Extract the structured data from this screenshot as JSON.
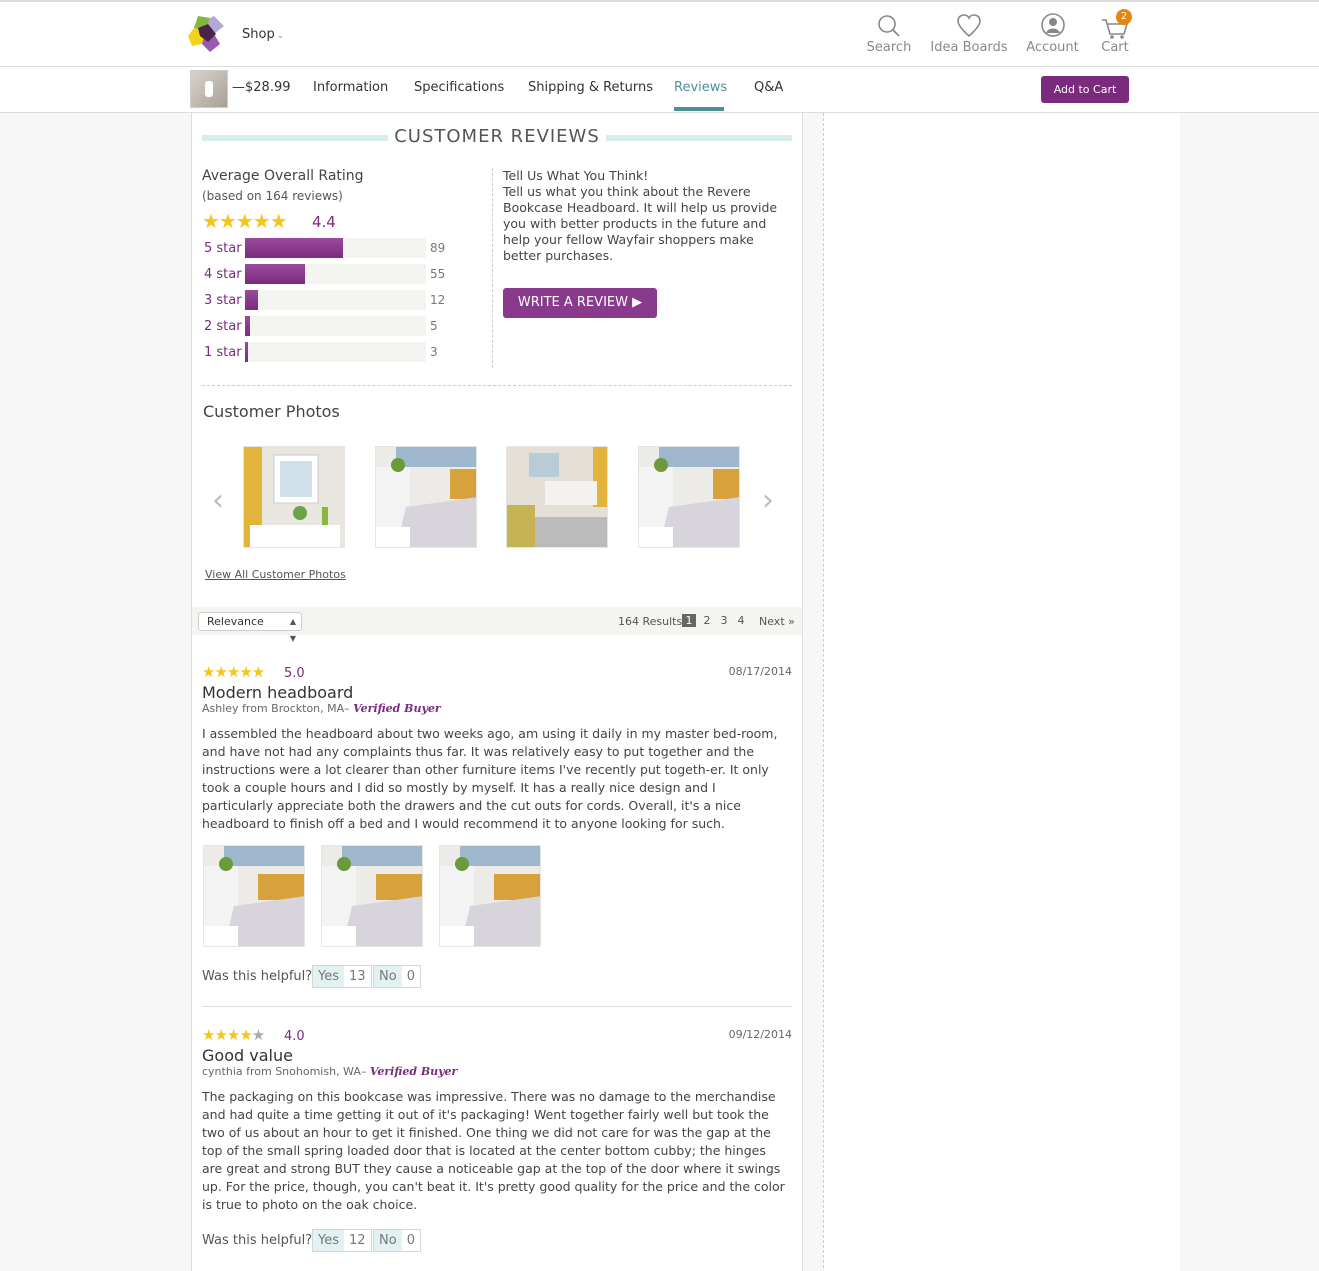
{
  "header": {
    "shop_label": "Shop",
    "nav": [
      {
        "label": "Search",
        "icon": "search-icon"
      },
      {
        "label": "Idea Boards",
        "icon": "heart-icon"
      },
      {
        "label": "Account",
        "icon": "account-icon"
      },
      {
        "label": "Cart",
        "icon": "cart-icon",
        "badge": "2"
      }
    ],
    "colors": {
      "accent": "#7b2b7e",
      "teal": "#4e8f9a",
      "badge": "#e8850f"
    }
  },
  "subnav": {
    "price": "—$28.99",
    "tabs": [
      "Information",
      "Specifications",
      "Shipping & Returns",
      "Reviews",
      "Q&A"
    ],
    "active_tab": "Reviews",
    "add_to_cart": "Add to Cart"
  },
  "reviews_summary": {
    "title": "CUSTOMER REVIEWS",
    "avg_label": "Average Overall Rating",
    "based_on": "(based on 164 reviews)",
    "avg_value": "4.4",
    "avg_stars": "★★★★★",
    "breakdown": [
      {
        "label": "5 star",
        "count": "89",
        "fraction": 0.54
      },
      {
        "label": "4 star",
        "count": "55",
        "fraction": 0.33
      },
      {
        "label": "3 star",
        "count": "12",
        "fraction": 0.07
      },
      {
        "label": "2 star",
        "count": "5",
        "fraction": 0.025
      },
      {
        "label": "1 star",
        "count": "3",
        "fraction": 0.018
      }
    ],
    "tell_title": "Tell Us What You Think!",
    "tell_body": "Tell us what you think about the Revere Bookcase Headboard. It will help us provide you with better products in the future and help your fellow Wayfair shoppers make better purchases.",
    "write_button": "WRITE A REVIEW ▶"
  },
  "customer_photos": {
    "title": "Customer Photos",
    "view_all": "View All Customer Photos"
  },
  "toolbar": {
    "sort_value": "Relevance",
    "results": "164 Results",
    "pages": [
      "1",
      "2",
      "3",
      "4"
    ],
    "current_page": "1",
    "next": "Next »"
  },
  "reviews": [
    {
      "stars": "★★★★★",
      "score": "5.0",
      "date": "08/17/2014",
      "title": "Modern headboard",
      "author": "Ashley from Brockton, MA–",
      "verified": "Verified Buyer",
      "body": "I assembled the headboard about two weeks ago, am using it daily in my master bed-room, and have not had any complaints thus far. It was relatively easy to put together and the instructions were a lot clearer than other furniture items I've recently put togeth-er. It only took a couple hours and I did so mostly by myself. It has a really nice design and I particularly appreciate both the drawers and the cut outs for cords. Overall, it's a nice headboard to finish off a bed and I would recommend it to anyone looking for such.",
      "helpful_label": "Was this helpful?",
      "yes_label": "Yes",
      "yes_count": "13",
      "no_label": "No",
      "no_count": "0"
    },
    {
      "stars": "★★★★",
      "stars_grey": "★",
      "score": "4.0",
      "date": "09/12/2014",
      "title": "Good value",
      "author": "cynthia from Snohomish, WA–",
      "verified": "Verified Buyer",
      "body": "The packaging on this bookcase was impressive. There was no damage to the merchandise and had quite a time getting it out of it's packaging! Went together fairly well but took the two of us about an hour to get it finished. One thing we did not care for was the gap at the top of the small spring loaded door that is located at the center bottom cubby; the hinges are great and strong BUT they cause a noticeable gap at the top of the door where it swings up. For the price, though, you can't beat it. It's pretty good quality for the price and the color is true to photo on the oak choice.",
      "helpful_label": "Was this helpful?",
      "yes_label": "Yes",
      "yes_count": "12",
      "no_label": "No",
      "no_count": "0"
    }
  ]
}
